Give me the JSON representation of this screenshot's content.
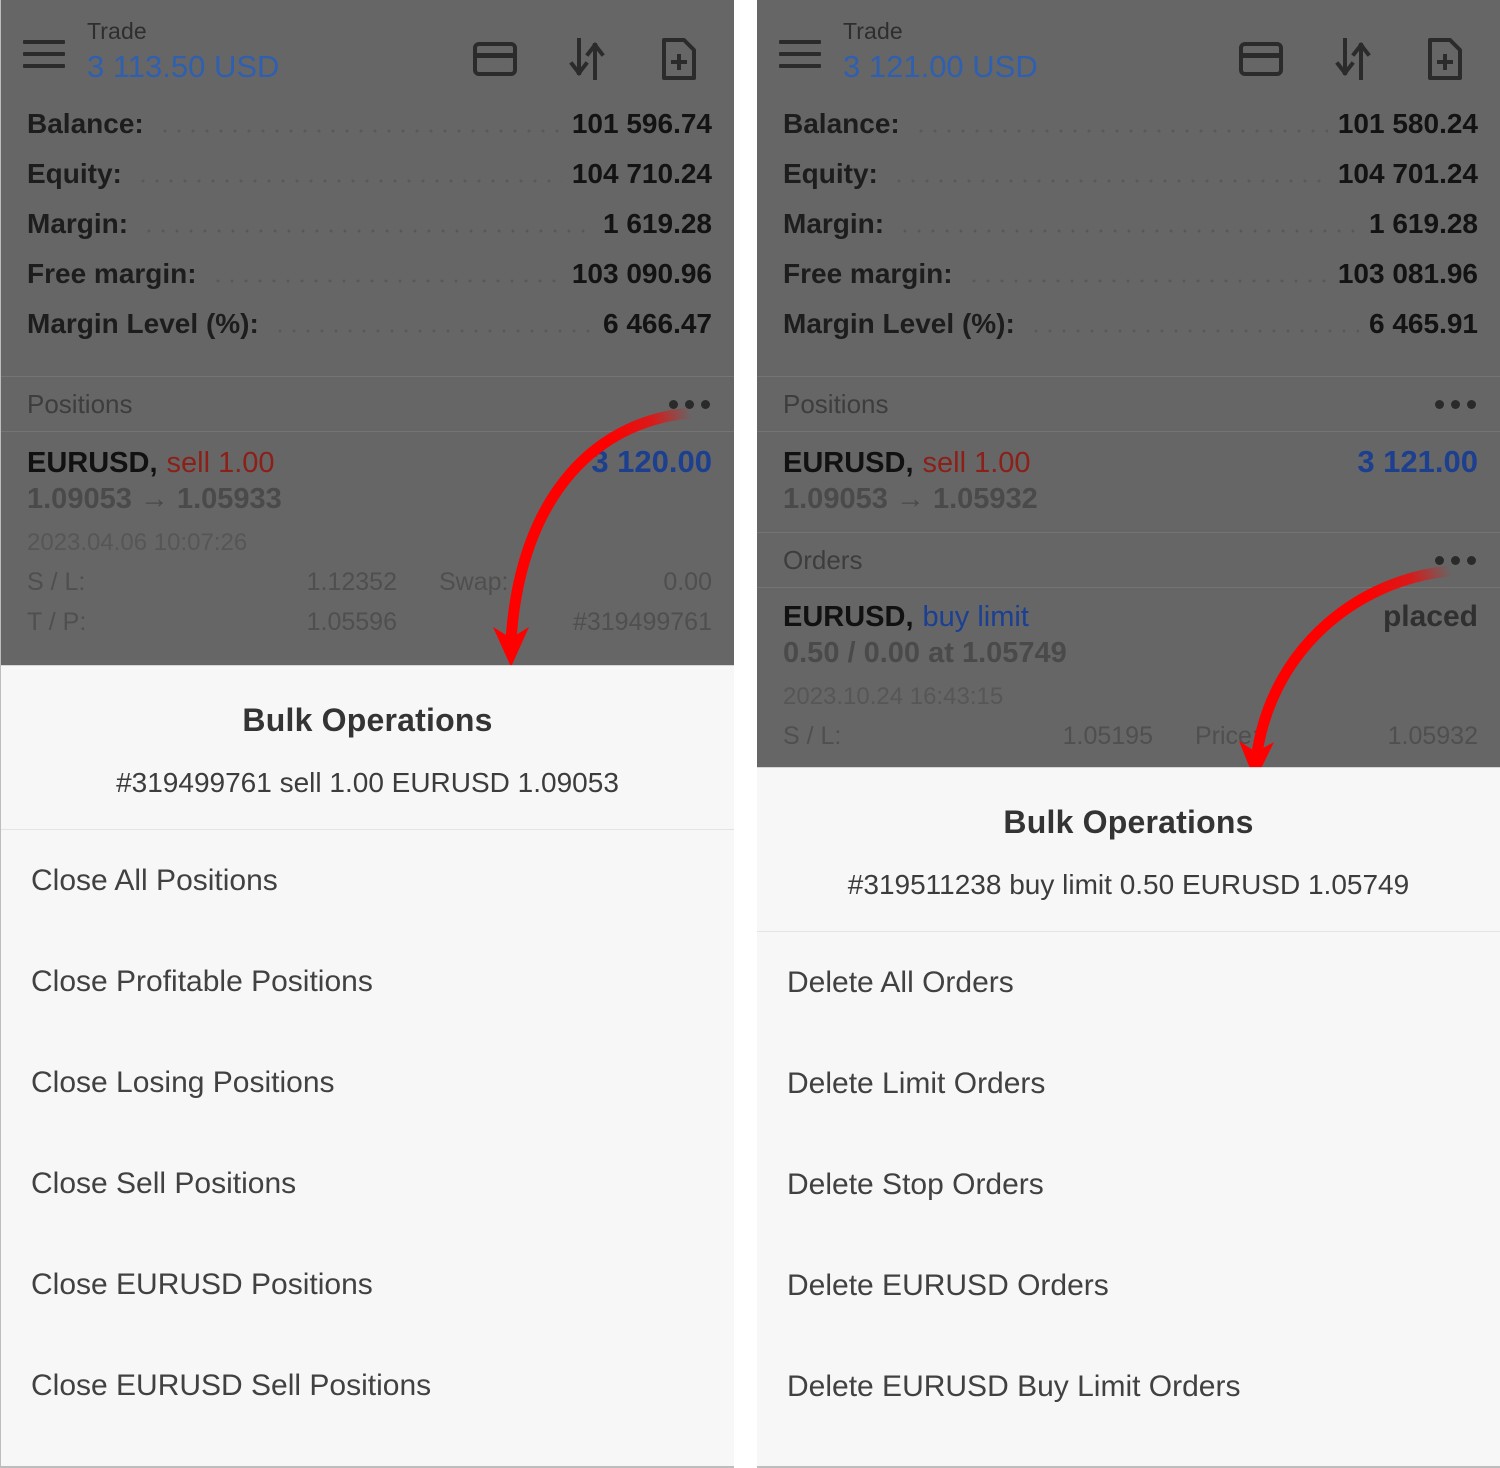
{
  "panels": [
    {
      "id": "left",
      "appbar": {
        "menu_icon": "hamburger-icon",
        "account_label": "Trade",
        "account_value": "3 113.50 USD",
        "icons": [
          "credit-card-icon",
          "sort-arrows-icon",
          "new-order-icon"
        ]
      },
      "summary": [
        {
          "label": "Balance:",
          "value": "101 596.74"
        },
        {
          "label": "Equity:",
          "value": "104 710.24"
        },
        {
          "label": "Margin:",
          "value": "1 619.28"
        },
        {
          "label": "Free margin:",
          "value": "103 090.96"
        },
        {
          "label": "Margin Level (%):",
          "value": "6 466.47"
        }
      ],
      "sections": [
        {
          "title": "Positions",
          "kebab": "more-options-icon",
          "rows": [
            {
              "symbol": "EURUSD,",
              "side": "sell 1.00",
              "side_kind": "sell",
              "prices": "1.09053  →  1.05933",
              "profit": "3 120.00",
              "time": "2023.04.06 10:07:26",
              "kv": [
                {
                  "k1": "S / L:",
                  "v1": "1.12352",
                  "k2": "Swap:",
                  "v2": "0.00"
                },
                {
                  "k1": "T / P:",
                  "v1": "1.05596",
                  "k2": "",
                  "v2": "#319499761"
                }
              ]
            }
          ]
        }
      ],
      "sheet": {
        "title": "Bulk Operations",
        "subtitle": "#319499761 sell 1.00 EURUSD 1.09053",
        "items": [
          "Close All Positions",
          "Close Profitable Positions",
          "Close Losing Positions",
          "Close Sell Positions",
          "Close EURUSD Positions",
          "Close EURUSD Sell Positions"
        ]
      }
    },
    {
      "id": "right",
      "appbar": {
        "menu_icon": "hamburger-icon",
        "account_label": "Trade",
        "account_value": "3 121.00 USD",
        "icons": [
          "credit-card-icon",
          "sort-arrows-icon",
          "new-order-icon"
        ]
      },
      "summary": [
        {
          "label": "Balance:",
          "value": "101 580.24"
        },
        {
          "label": "Equity:",
          "value": "104 701.24"
        },
        {
          "label": "Margin:",
          "value": "1 619.28"
        },
        {
          "label": "Free margin:",
          "value": "103 081.96"
        },
        {
          "label": "Margin Level (%):",
          "value": "6 465.91"
        }
      ],
      "sections": [
        {
          "title": "Positions",
          "kebab": "more-options-icon",
          "rows": [
            {
              "symbol": "EURUSD,",
              "side": "sell 1.00",
              "side_kind": "sell",
              "prices": "1.09053  →  1.05932",
              "profit": "3 121.00"
            }
          ]
        },
        {
          "title": "Orders",
          "kebab": "more-options-icon",
          "rows": [
            {
              "symbol": "EURUSD,",
              "side": "buy limit",
              "side_kind": "buy",
              "prices": "0.50 / 0.00 at 1.05749",
              "state": "placed",
              "time": "2023.10.24 16:43:15",
              "kv": [
                {
                  "k1": "S / L:",
                  "v1": "1.05195",
                  "k2": "Price:",
                  "v2": "1.05932"
                }
              ]
            }
          ]
        }
      ],
      "sheet": {
        "title": "Bulk Operations",
        "subtitle": "#319511238 buy limit 0.50 EURUSD 1.05749",
        "items": [
          "Delete All Orders",
          "Delete Limit Orders",
          "Delete Stop Orders",
          "Delete EURUSD Orders",
          "Delete EURUSD Buy Limit Orders"
        ]
      }
    }
  ],
  "annotations": {
    "arrow_color": "#ff0000",
    "left_arrow": "curved-arrow-to-positions-menu",
    "right_arrow": "curved-arrow-to-orders-menu"
  }
}
